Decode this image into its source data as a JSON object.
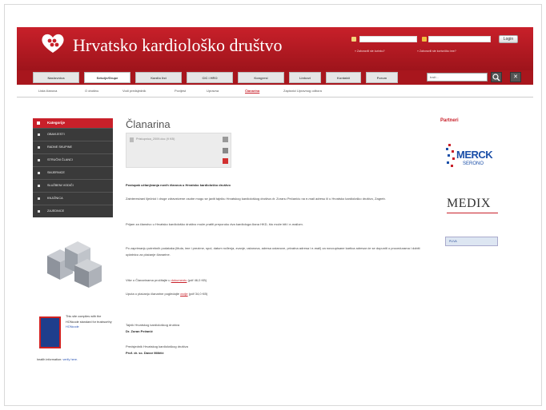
{
  "header": {
    "title": "Hrvatsko kardiološko društvo",
    "login_button": "Login",
    "forgot_link": "» Zaboravili ste lozinku?",
    "register_link": "» Zaboravili ste korisničko ime?"
  },
  "nav": {
    "tabs": [
      "Naslovnica",
      "Sekcije/Grupe",
      "Kardio list",
      "CIC i HRO",
      "Kongresi",
      "Linkovi",
      "Kontakti",
      "Forum"
    ],
    "active_index": 1,
    "search_placeholder": "traži...",
    "close_symbol": "✕"
  },
  "subnav": {
    "items": [
      "Lista članova",
      "O društvu",
      "Vodi predsjednik",
      "Povijest",
      "Upravna",
      "Članarina",
      "Zapisnici Upravnog odbora"
    ],
    "active_index": 5
  },
  "sidebar": {
    "heading": "Kategorije",
    "items": [
      "OBAVIJESTI",
      "RADNE SKUPINE",
      "STRUČNI ČLANCI",
      "SMJERNICE",
      "SLUŽBENI VODIČI",
      "KNJIŽNICA",
      "ZAJEDNICE"
    ],
    "hon_text": "This site complies with the HONcode standard for trustworthy",
    "hon_link": "HONcode",
    "hon_tail": "health information:",
    "hon_verify": "verify here."
  },
  "main": {
    "title": "Članarina",
    "doc_file": "Pristupnica_2009.doc (9 KB)",
    "heading": "Postupak učlanjivanja novih članova u Hrvatsko kardiološko društvo",
    "p1": "Zainteresirani liječnici i druge zdravstvene osobe mogu se javiti tajniku Hrvatskog kardiološkog društva dr. Zoranu Pečaniću na e-mail adresu ili u Hrvatsko kardiološko društvo, Zagreb.",
    "p2": "Prijam za članstvo u Hrvatsko kardiološko društvo može pratiti preporuku dva kardiologa člana HKD, što može biti i e-mailom.",
    "p3": "Po zaprimanju potrebnih podataka (titula, ime i prezime, spol, datum rođenja, zvanje, ustanova, adresa ustanove, privatna adresa i e-mail) za novoupisane kartica adresar će se dopuniti o procedurama i dobiti uplatnicu za plaćanje članarine.",
    "p4_prefix": "Više o Članarinama pročitajte u",
    "p4_link": "dokumentu",
    "p4_suffix": "(pdf 46,0 KB)",
    "p5_prefix": "Uputa o plaćanju članarine pogledajte",
    "p5_link": "ovdje",
    "p5_suffix": "(pdf 34,0 KB)",
    "sig1_role": "Tajnik Hrvatskog kardiološkog društva",
    "sig1_name": "Dr. Zoran Pečanić",
    "sig2_role": "Predsjednik Hrvatskog kardiološkog društva",
    "sig2_name": "Prof. dr. sc. Davor Miličić"
  },
  "partners": {
    "title": "Partneri",
    "merck": "MERCK",
    "serono": "SERONO",
    "medix": "MEDIX",
    "pliva": "PLIVA"
  },
  "colors": {
    "brand_red": "#c8202a",
    "nav_dark": "#a8161d",
    "sidebar_dark": "#3a3a3a",
    "merck_blue": "#1b4fa8"
  }
}
